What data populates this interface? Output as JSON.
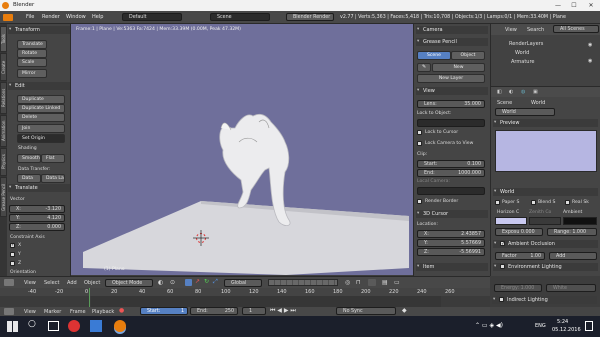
{
  "window": {
    "title": "Blender",
    "min": "—",
    "max": "☐",
    "close": "✕"
  },
  "menu": [
    "File",
    "Render",
    "Window",
    "Help"
  ],
  "layout": {
    "value": "Default",
    "scene": "Scene",
    "engine": "Blender Render"
  },
  "stats": "v2.77 | Verts:5,363 | Faces:5,418 | Tris:10,708 | Objects:1/3 | Lamps:0/1 | Mem:33.40M | Plane",
  "left_tabs": [
    "Tools",
    "Create",
    "Relations",
    "Animation",
    "Physics",
    "Grease Pencil"
  ],
  "toolshelf": {
    "transform": {
      "title": "Transform",
      "buttons": [
        "Translate",
        "Rotate",
        "Scale",
        "Mirror"
      ]
    },
    "edit": {
      "title": "Edit",
      "buttons": [
        "Duplicate",
        "Duplicate Linked",
        "Delete",
        "Join"
      ],
      "set_origin": "Set Origin"
    },
    "shading": {
      "title": "Shading",
      "smooth": "Smooth",
      "flat": "Flat"
    },
    "data_transfer": {
      "title": "Data Transfer:",
      "data": "Data",
      "data_la": "Data La"
    },
    "translate": {
      "title": "Translate",
      "vector": "Vector",
      "x": "X:",
      "x_val": "-3.120",
      "y": "Y:",
      "y_val": "4.120",
      "z": "Z:",
      "z_val": "0.000",
      "constraint_axis": "Constraint Axis",
      "cx": "X",
      "cy": "Y",
      "cz": "Z",
      "orientation": "Orientation"
    }
  },
  "viewport": {
    "title": "Frame:1 | Plane | Ve:5363 Fa:7424 | Mem:33.39M (0.00M, Peak 47.32M)",
    "object_label": "(1) Plane"
  },
  "rpanel": {
    "camera": "Camera",
    "grease_pencil": "Grease Pencil",
    "scene": "Scene",
    "object": "Object",
    "new": "New",
    "new_layer": "New Layer",
    "view": "View",
    "lens": "Lens:",
    "lens_val": "35.000",
    "lock_to_object": "Lock to Object:",
    "lock_to_cursor": "Lock to Cursor",
    "lock_camera": "Lock Camera to View",
    "clip": "Clip:",
    "start": "Start:",
    "start_val": "0.100",
    "end": "End:",
    "end_val": "1000.000",
    "local_camera": "Local Camera:",
    "render_border": "Render Border",
    "cursor": "3D Cursor",
    "location": "Location:",
    "lx": "X:",
    "lx_val": "2.43857",
    "ly": "Y:",
    "ly_val": "5.57669",
    "lz": "Z:",
    "lz_val": "-5.56991",
    "item": "Item"
  },
  "outliner": {
    "view": "View",
    "search": "Search",
    "all_scenes": "All Scenes",
    "items": [
      "RenderLayers",
      "World",
      "Armature"
    ]
  },
  "props": {
    "scene": "Scene",
    "world_breadcrumb": "World",
    "world_name": "World",
    "preview": "Preview",
    "world": "World",
    "paper_sky": "Paper S",
    "blend_sky": "Blend S",
    "real_sky": "Real Sk",
    "horizon": "Horizon C",
    "zenith": "Zenith Co",
    "ambient": "Ambient",
    "exposure": "Exposu 0.000",
    "range": "Range: 1.000",
    "ao": "Ambient Occlusion",
    "factor": "Factor",
    "factor_val": "1.00",
    "add": "Add",
    "env": "Environment Lighting",
    "energy": "Energy: 1.000",
    "white": "White",
    "indirect": "Indirect Lighting"
  },
  "header3d": {
    "view": "View",
    "select": "Select",
    "add": "Add",
    "object": "Object",
    "mode": "Object Mode",
    "orientation": "Global"
  },
  "timeline": {
    "ticks": [
      "-40",
      "-20",
      "0",
      "20",
      "40",
      "60",
      "80",
      "100",
      "120",
      "140",
      "160",
      "180",
      "200",
      "220",
      "240",
      "260"
    ],
    "view": "View",
    "marker": "Marker",
    "frame": "Frame",
    "playback": "Playback",
    "start": "Start:",
    "start_val": "1",
    "end": "End:",
    "end_val": "250",
    "current": "1",
    "sync": "No Sync"
  },
  "taskbar": {
    "lang": "ENG",
    "time": "5:24",
    "date": "05.12.2016"
  },
  "colors": {
    "viewport": "#6f6f9b",
    "panel": "#454545",
    "accent": "#5680c2"
  }
}
